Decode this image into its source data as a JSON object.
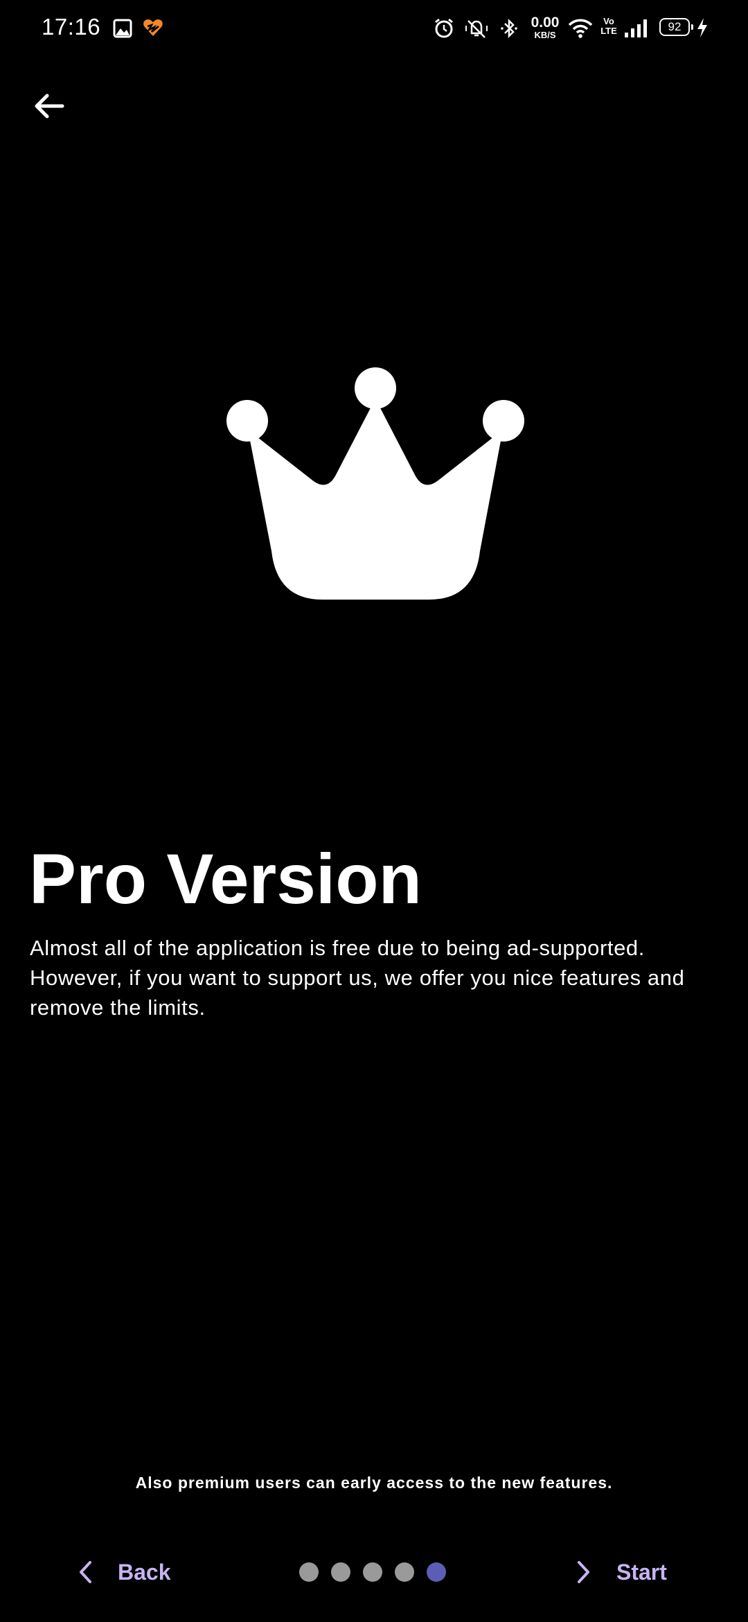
{
  "status_bar": {
    "time": "17:16",
    "net_speed_value": "0.00",
    "net_speed_unit": "KB/S",
    "volte_line1": "Vo",
    "volte_line2": "LTE",
    "battery": "92",
    "icons": [
      "gallery-icon",
      "heart-app-icon",
      "alarm-icon",
      "mute-icon",
      "bluetooth-icon",
      "wifi-icon",
      "signal-icon",
      "charging-icon"
    ]
  },
  "header": {
    "back_icon": "arrow-left-icon"
  },
  "hero": {
    "icon": "crown-icon"
  },
  "content": {
    "title": "Pro Version",
    "description": "Almost all of the application is free due to being ad-supported. However, if you want to support us, we offer you nice features and remove the limits.",
    "note": "Also premium users can early access to the new features."
  },
  "footer": {
    "back_label": "Back",
    "start_label": "Start",
    "pages_total": 5,
    "current_page": 5
  },
  "colors": {
    "background": "#000000",
    "accent": "#c8b4f2",
    "dot_active": "#5b5fb4",
    "dot_inactive": "#9a9a9a"
  }
}
